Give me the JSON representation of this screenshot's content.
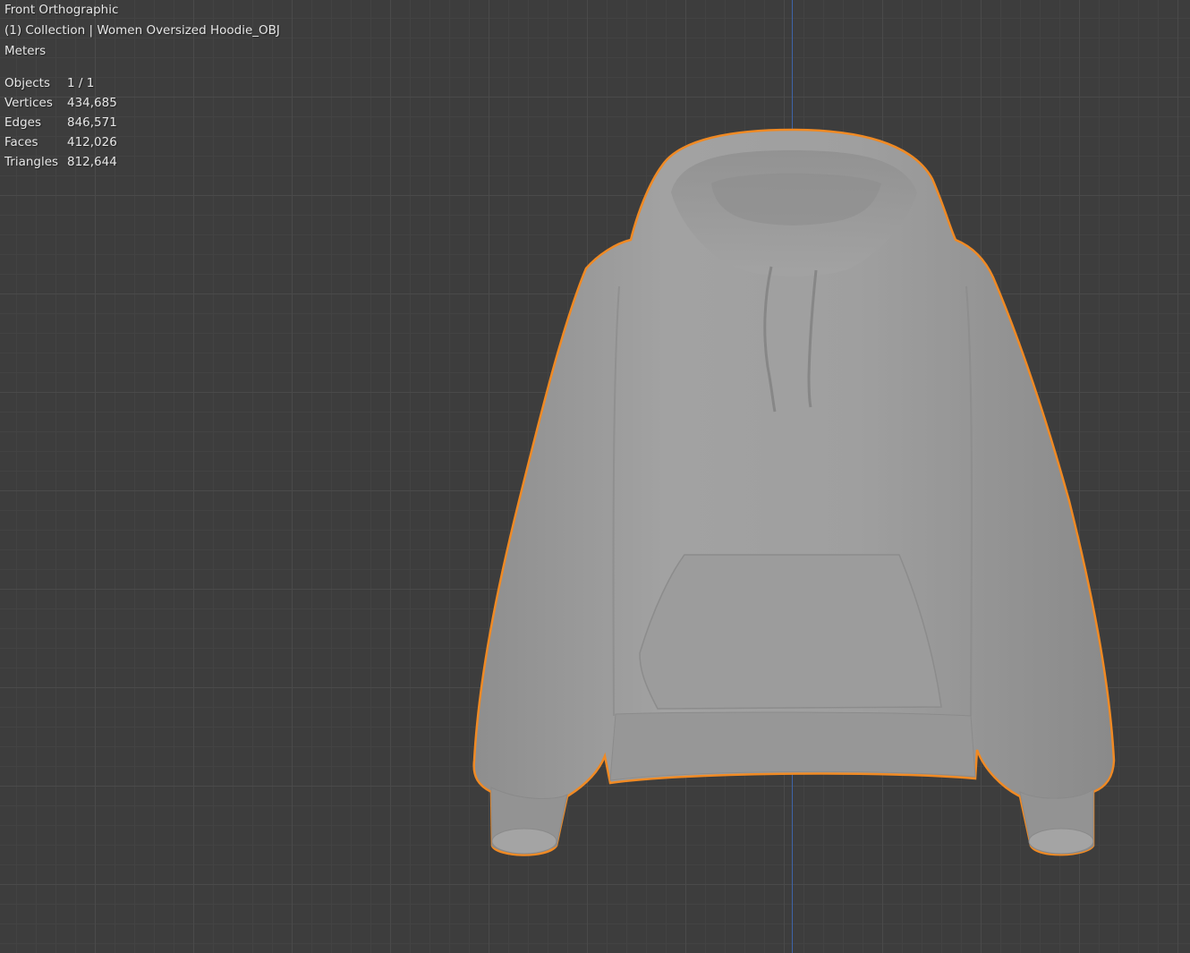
{
  "viewport": {
    "view_name": "Front Orthographic",
    "collection_line": "(1) Collection | Women Oversized Hoodie_OBJ",
    "units": "Meters"
  },
  "stats": [
    {
      "label": "Objects",
      "value": "1 / 1"
    },
    {
      "label": "Vertices",
      "value": "434,685"
    },
    {
      "label": "Edges",
      "value": "846,571"
    },
    {
      "label": "Faces",
      "value": "412,026"
    },
    {
      "label": "Triangles",
      "value": "812,644"
    }
  ],
  "colors": {
    "background": "#3d3d3d",
    "grid": "#4a4a4a",
    "z_axis": "#3e64a8",
    "selection_outline": "#f08a24",
    "model_fill": "#9a9a9a"
  }
}
